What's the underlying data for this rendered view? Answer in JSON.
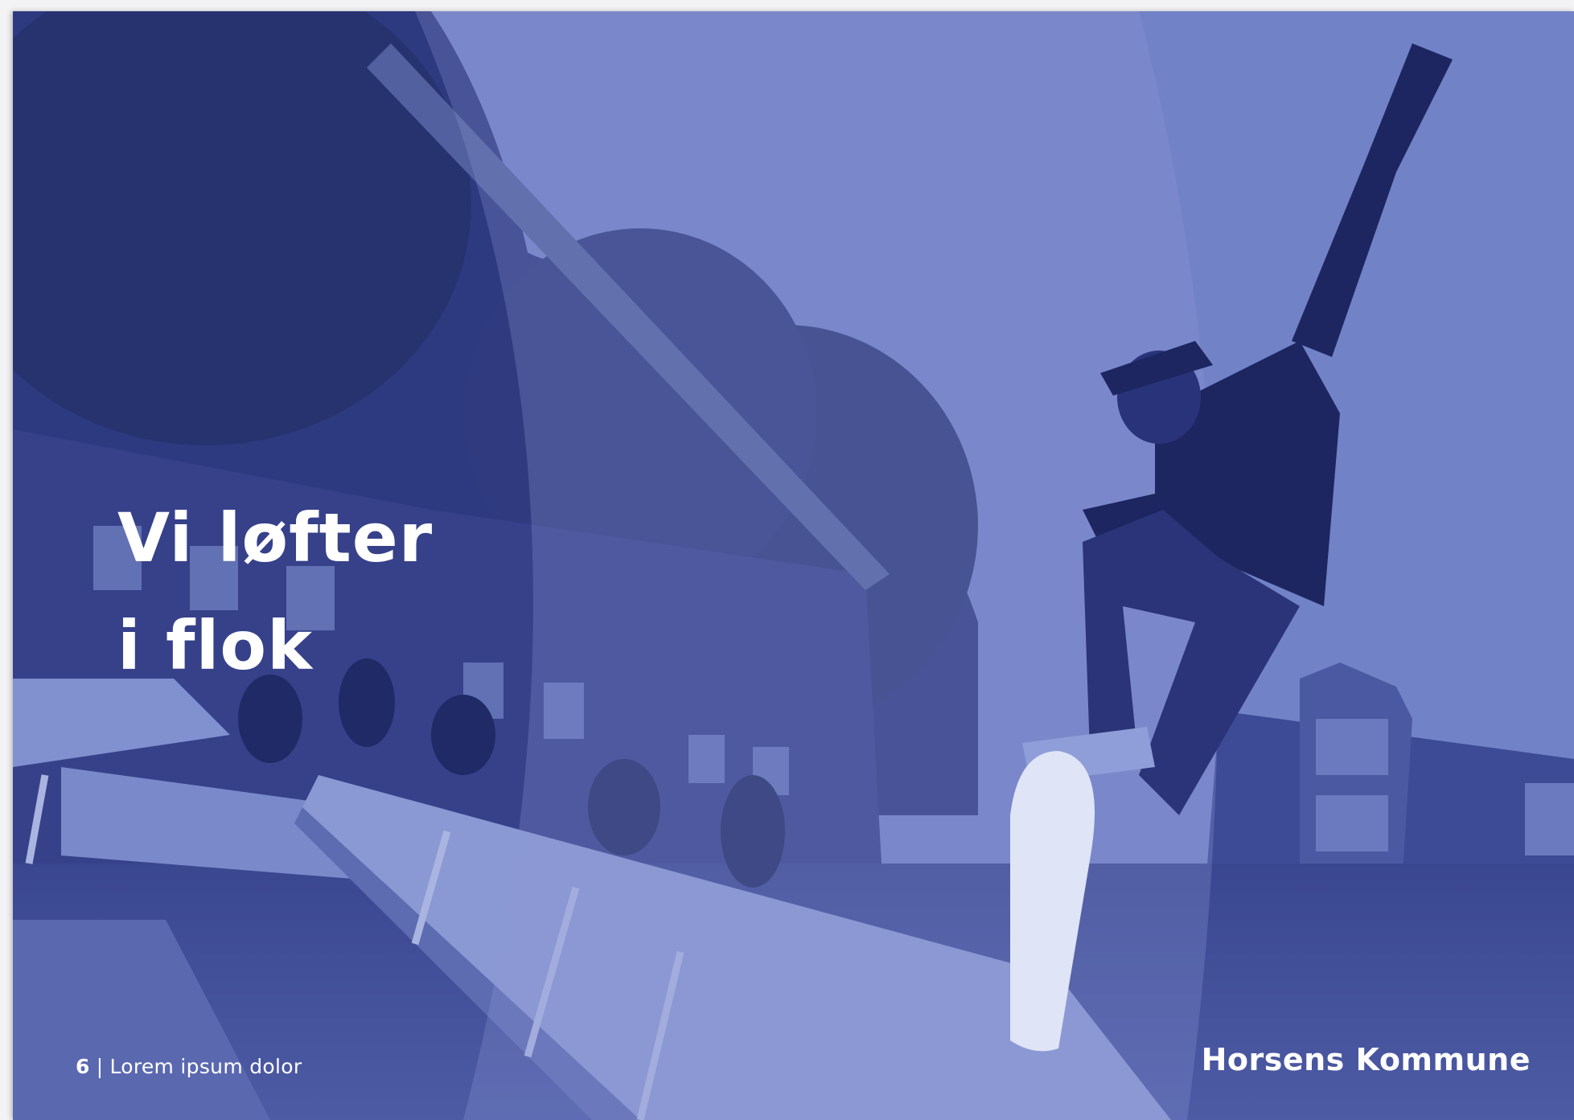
{
  "headline": {
    "line1": "Vi løfter",
    "line2": "i flok"
  },
  "footer": {
    "page_number": "6",
    "separator": "|",
    "section": "Lorem ipsum dolor"
  },
  "brand": {
    "name": "Horsens Kommune"
  },
  "colors": {
    "duotone_light": "#7585c8",
    "duotone_dark": "#2a3779",
    "text": "#ffffff"
  }
}
